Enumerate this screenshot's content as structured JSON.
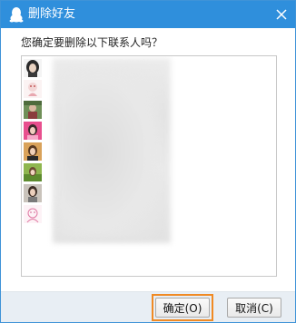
{
  "window": {
    "title": "删除好友",
    "accent_color": "#2f8fdc",
    "title_icon": "qq-penguin-icon",
    "close_icon": "close-icon"
  },
  "dialog": {
    "prompt": "您确定要删除以下联系人吗？",
    "contacts": [
      {
        "avatar": "avatar-dark-hair-girl",
        "name": "",
        "blurred": true
      },
      {
        "avatar": "avatar-pink-cartoon",
        "name": "",
        "blurred": true
      },
      {
        "avatar": "avatar-green-photo",
        "name": "",
        "blurred": true
      },
      {
        "avatar": "avatar-pink-girl",
        "name": "",
        "blurred": true
      },
      {
        "avatar": "avatar-orange-girl",
        "name": "",
        "blurred": true
      },
      {
        "avatar": "avatar-green-field-girl",
        "name": "",
        "blurred": true
      },
      {
        "avatar": "avatar-grey-girl",
        "name": "",
        "blurred": true
      },
      {
        "avatar": "avatar-pink-sketch",
        "name": "",
        "blurred": true
      }
    ]
  },
  "footer": {
    "ok_label": "确定(O)",
    "cancel_label": "取消(C)",
    "highlight_color": "#f08a24"
  }
}
